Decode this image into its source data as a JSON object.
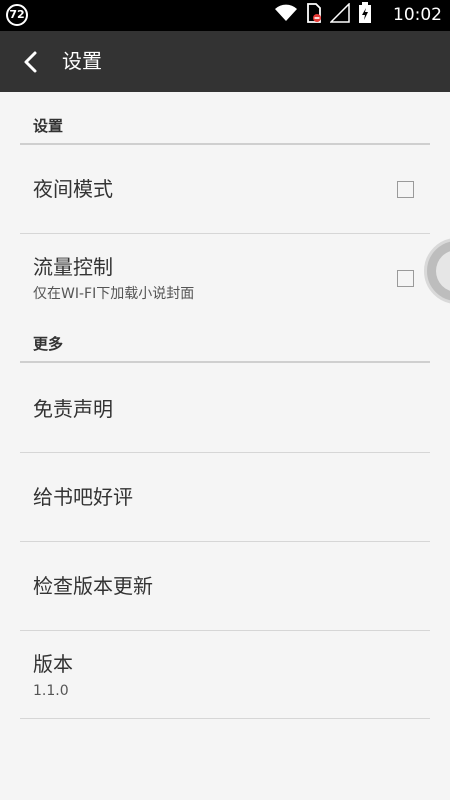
{
  "status_bar": {
    "badge": "72",
    "time": "10:02"
  },
  "app_bar": {
    "title": "设置"
  },
  "sections": {
    "settings": {
      "header": "设置",
      "night_mode": {
        "title": "夜间模式",
        "checked": false
      },
      "data_control": {
        "title": "流量控制",
        "subtitle": "仅在WI-FI下加载小说封面",
        "checked": false
      }
    },
    "more": {
      "header": "更多",
      "disclaimer": {
        "title": "免责声明"
      },
      "rate": {
        "title": "给书吧好评"
      },
      "check_update": {
        "title": "检查版本更新"
      },
      "version": {
        "title": "版本",
        "value": "1.1.0"
      }
    }
  }
}
